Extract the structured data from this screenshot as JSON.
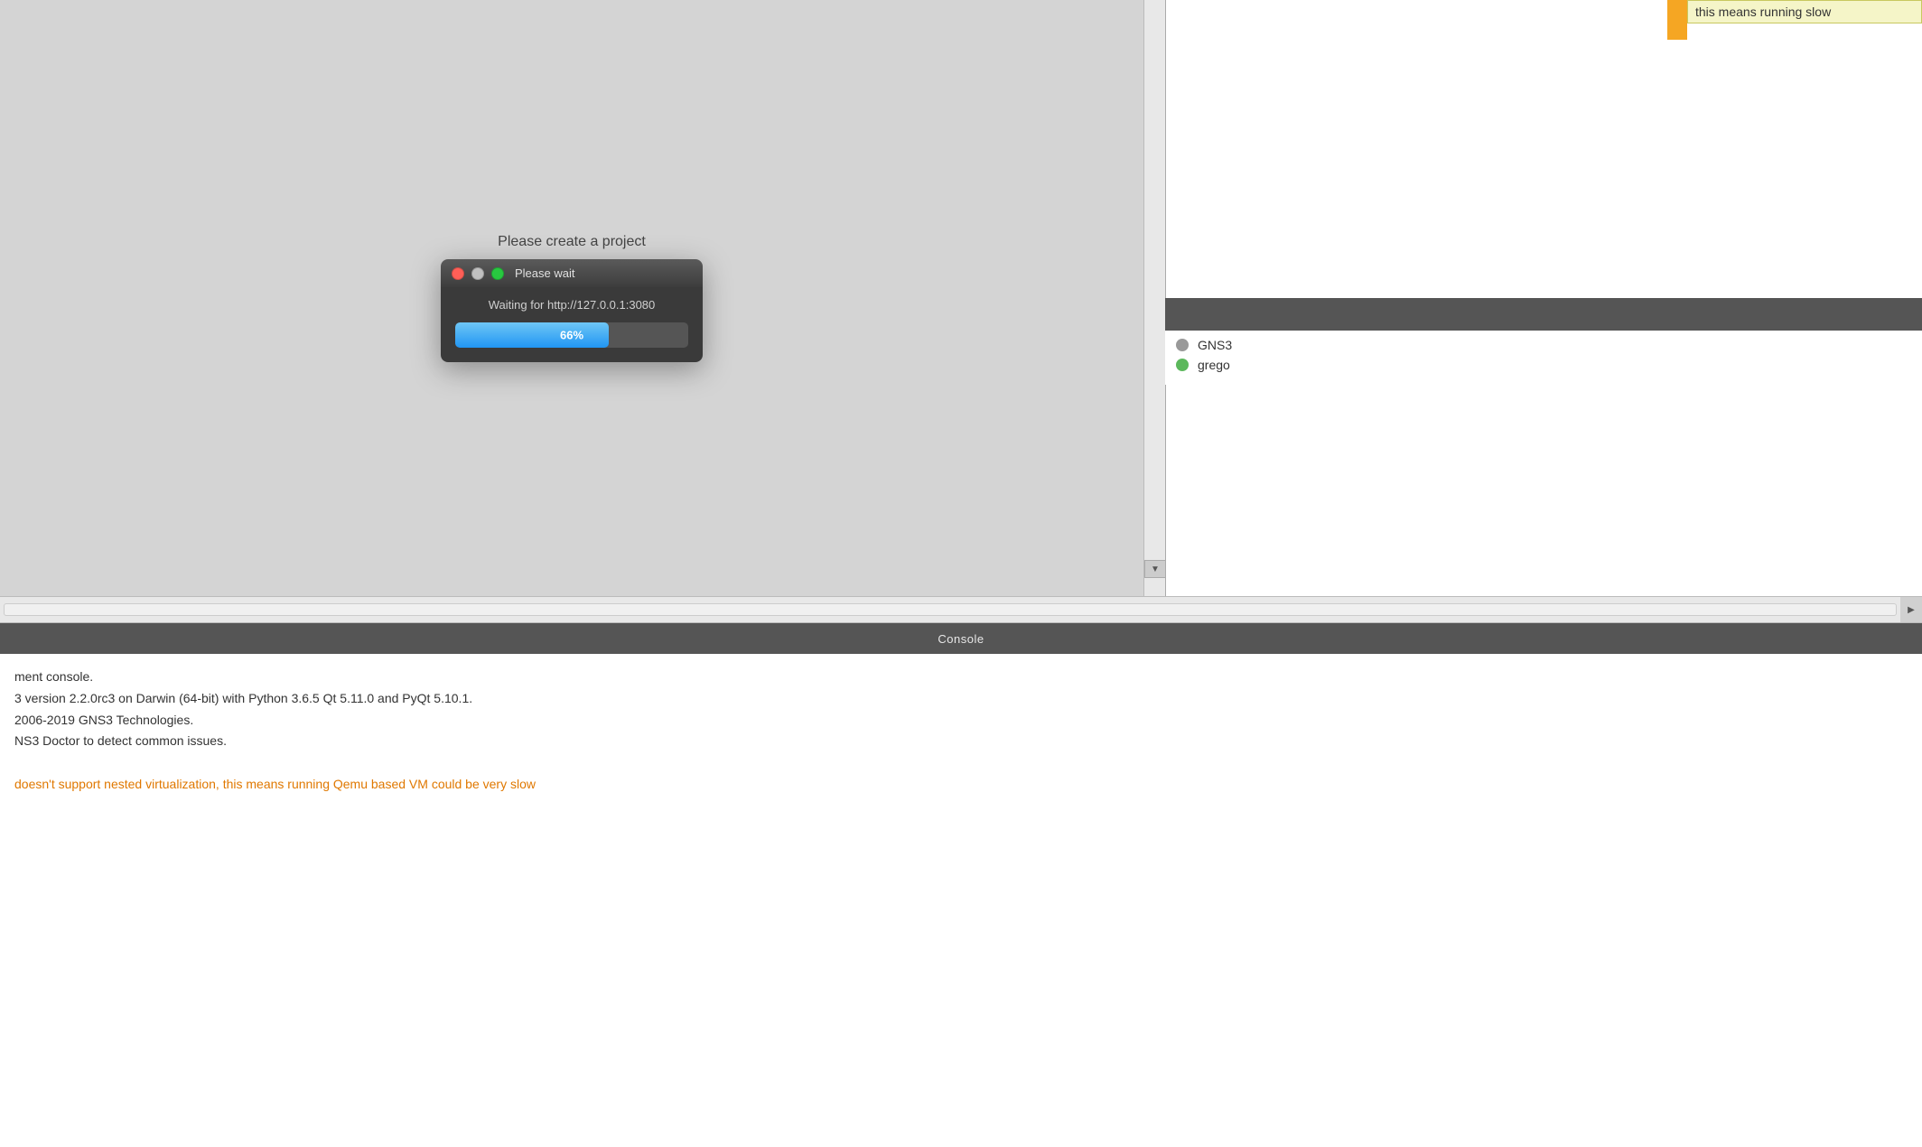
{
  "tooltip": {
    "text": "this means running slow",
    "bg_color": "#f5f5c8"
  },
  "dialog": {
    "title_above": "Please create a project",
    "titlebar_label": "Please wait",
    "waiting_text": "Waiting for http://127.0.0.1:3080",
    "progress_percent": 66,
    "progress_label": "66%"
  },
  "right_panel": {
    "servers": [
      {
        "name": "GNS3",
        "status": "gray"
      },
      {
        "name": "grego",
        "status": "green"
      }
    ]
  },
  "console": {
    "header_label": "Console",
    "lines": [
      "ment console.",
      "3 version 2.2.0rc3 on Darwin (64-bit) with Python 3.6.5 Qt 5.11.0 and PyQt 5.10.1.",
      "2006-2019 GNS3 Technologies.",
      "NS3 Doctor to detect common issues.",
      "",
      "doesn't support nested virtualization, this means running Qemu based VM could be very slow"
    ]
  },
  "icons": {
    "traffic_light_red": "●",
    "traffic_light_yellow": "●",
    "traffic_light_green": "●",
    "scroll_down": "▼",
    "scroll_right": "▶",
    "handle": "⠿"
  }
}
